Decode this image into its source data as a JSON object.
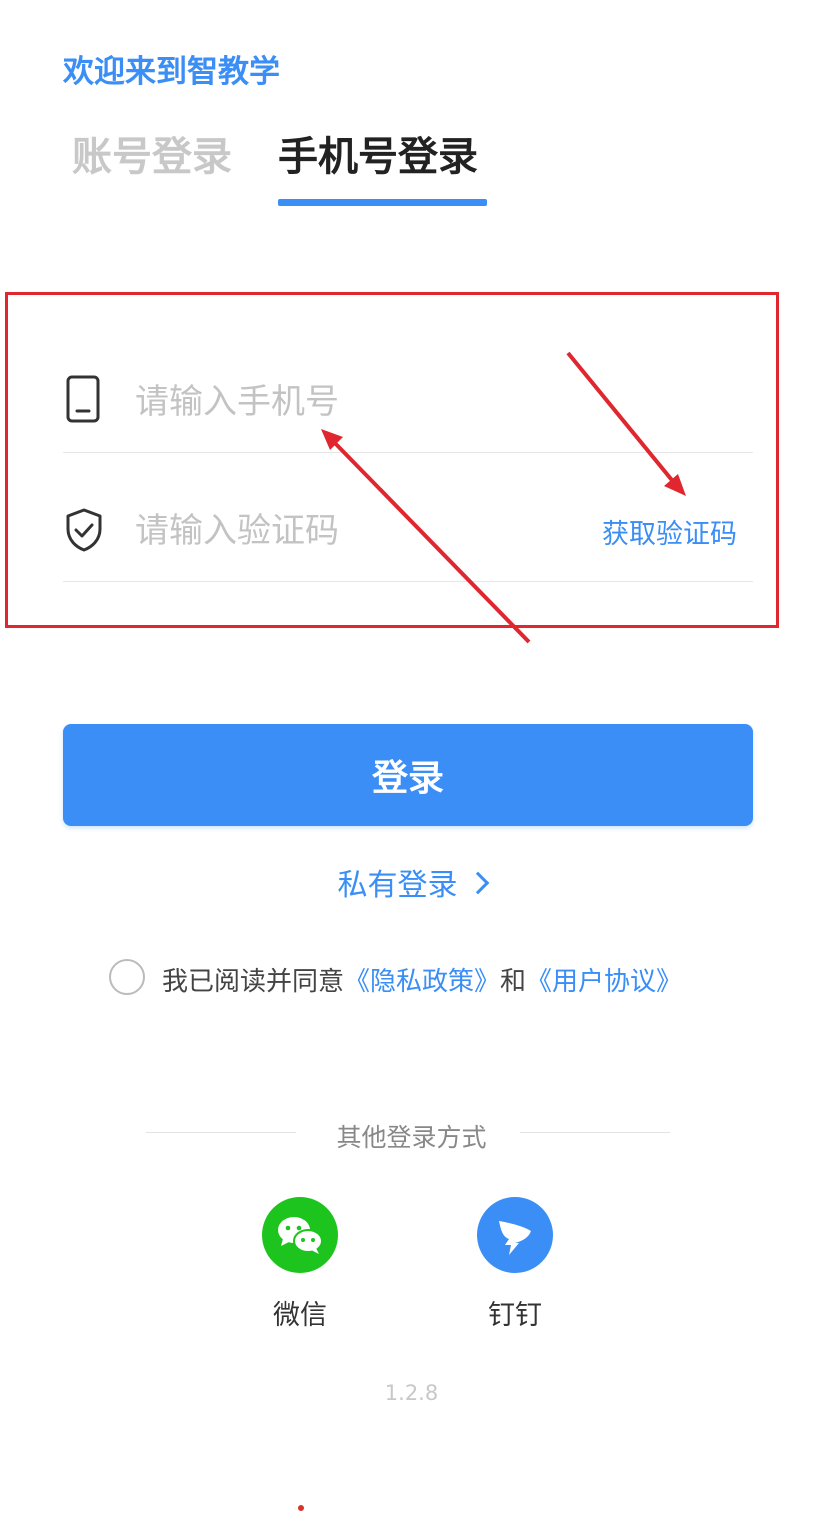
{
  "header": {
    "welcome": "欢迎来到智教学"
  },
  "tabs": [
    {
      "label": "账号登录",
      "active": false
    },
    {
      "label": "手机号登录",
      "active": true
    }
  ],
  "form": {
    "phone_placeholder": "请输入手机号",
    "phone_value": "",
    "code_placeholder": "请输入验证码",
    "code_value": "",
    "get_code_label": "获取验证码"
  },
  "actions": {
    "login_label": "登录",
    "private_login_label": "私有登录"
  },
  "agreement": {
    "checked": false,
    "prefix": "我已阅读并同意",
    "privacy_link": "《隐私政策》",
    "and": "和",
    "terms_link": "《用户协议》"
  },
  "other_login": {
    "title": "其他登录方式",
    "options": [
      {
        "label": "微信",
        "icon": "wechat-icon",
        "color": "#1ec41e"
      },
      {
        "label": "钉钉",
        "icon": "dingtalk-icon",
        "color": "#3a8ef6"
      }
    ]
  },
  "version": "1.2.8",
  "colors": {
    "accent": "#3a8ef6",
    "annotation": "#e0262e"
  }
}
